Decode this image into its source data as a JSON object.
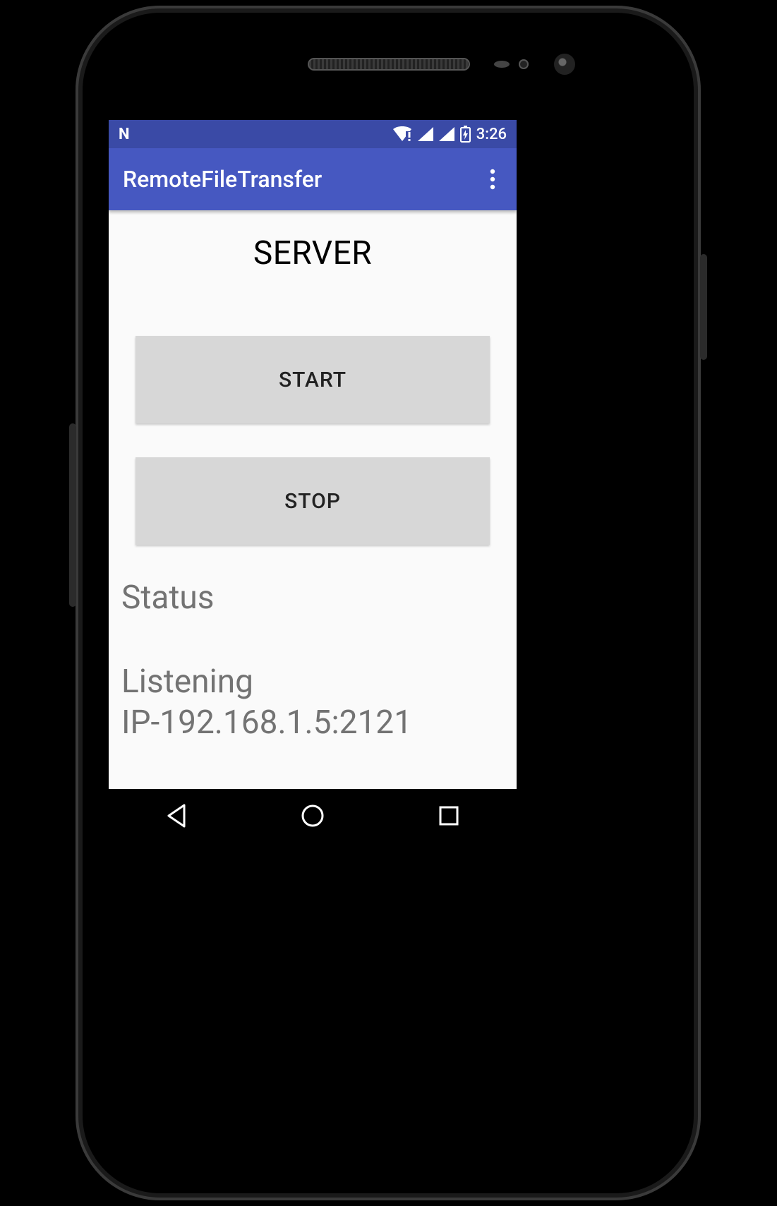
{
  "statusbar": {
    "n_indicator": "N",
    "clock": "3:26"
  },
  "appbar": {
    "title": "RemoteFileTransfer"
  },
  "main": {
    "heading": "SERVER",
    "start_label": "START",
    "stop_label": "STOP",
    "status_label": "Status",
    "status_text": "Listening\nIP-192.168.1.5:2121"
  },
  "colors": {
    "statusbar": "#3a4aa6",
    "appbar": "#4658c1",
    "button_bg": "#d7d7d7",
    "muted_text": "#737373"
  }
}
